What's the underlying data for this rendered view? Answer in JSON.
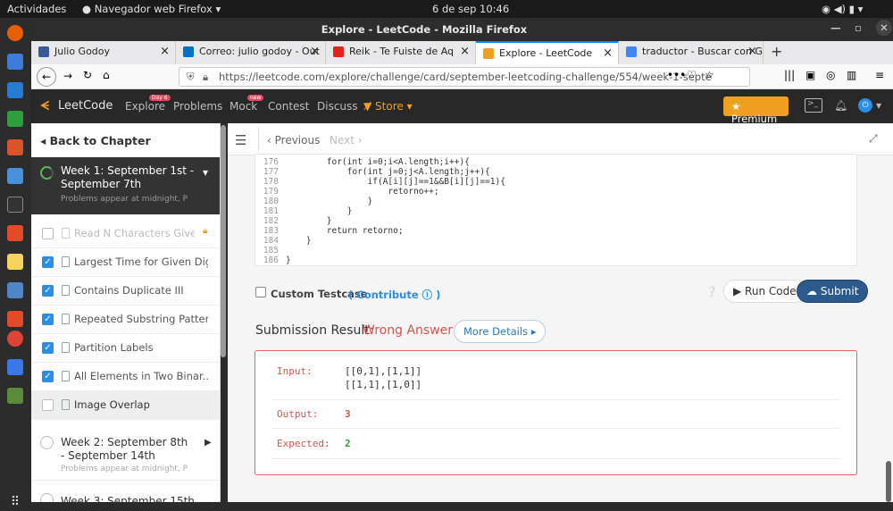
{
  "os": {
    "activities": "Actividades",
    "app": "Navegador web Firefox",
    "clock": "6 de sep  10:46"
  },
  "window_title": "Explore - LeetCode - Mozilla Firefox",
  "tabs": [
    {
      "label": "Julio Godoy",
      "color": "#3b5998"
    },
    {
      "label": "Correo: julio godoy - Out",
      "color": "#0072c6"
    },
    {
      "label": "Reik - Te Fuiste de Aq",
      "color": "#e62117"
    },
    {
      "label": "Explore - LeetCode",
      "color": "#f0a020"
    },
    {
      "label": "traductor - Buscar con Go",
      "color": "#4285f4"
    }
  ],
  "url": "https://leetcode.com/explore/challenge/card/september-leetcoding-challenge/554/week-1-septe",
  "lc": {
    "brand": "LeetCode",
    "nav": [
      "Explore",
      "Problems",
      "Mock",
      "Contest",
      "Discuss"
    ],
    "store": "Store",
    "premium": "Premium",
    "badge_explore": "Day 6",
    "badge_mock": "new"
  },
  "sidebar": {
    "back": "Back to Chapter",
    "week1": "Week 1: September 1st - September 7th",
    "week1_sub": "Problems appear at midnight, P",
    "items": [
      "Read N Characters Given ...",
      "Largest Time for Given Digits",
      "Contains Duplicate III",
      "Repeated Substring Pattern",
      "Partition Labels",
      "All Elements in Two Binar...",
      "Image Overlap"
    ],
    "week2": "Week 2: September 8th - September 14th",
    "week2_sub": "Problems appear at midnight, P",
    "week3": "Week 3: September 15th"
  },
  "toolbar": {
    "previous": "Previous",
    "next": "Next"
  },
  "code": {
    "lines": [
      {
        "n": "176",
        "t": "        for(int i=0;i<A.length;i++){"
      },
      {
        "n": "177",
        "t": "            for(int j=0;j<A.length;j++){"
      },
      {
        "n": "178",
        "t": "                if(A[i][j]==1&&B[i][j]==1){"
      },
      {
        "n": "179",
        "t": "                    retorno++;"
      },
      {
        "n": "180",
        "t": "                }"
      },
      {
        "n": "181",
        "t": "            }"
      },
      {
        "n": "182",
        "t": "        }"
      },
      {
        "n": "183",
        "t": "        return retorno;"
      },
      {
        "n": "184",
        "t": "    }"
      },
      {
        "n": "185",
        "t": ""
      },
      {
        "n": "186",
        "t": "}"
      }
    ]
  },
  "actions": {
    "custom_testcase": "Custom Testcase",
    "contribute": "Contribute",
    "run": "Run Code",
    "submit": "Submit"
  },
  "result": {
    "label": "Submission Result:",
    "status": "Wrong Answer",
    "more": "More Details",
    "input_label": "Input:",
    "input_1": "[[0,1],[1,1]]",
    "input_2": "[[1,1],[1,0]]",
    "output_label": "Output:",
    "output": "3",
    "expected_label": "Expected:",
    "expected": "2"
  }
}
